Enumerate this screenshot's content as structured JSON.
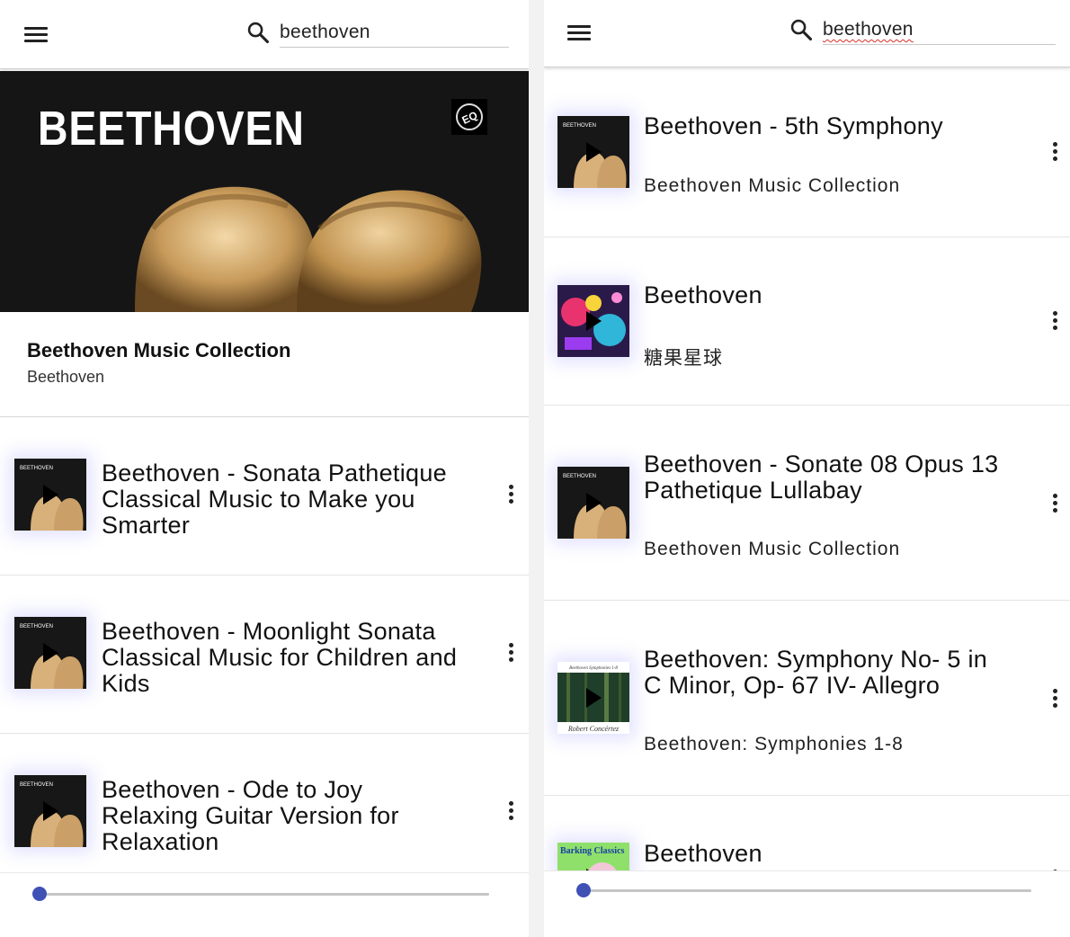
{
  "left": {
    "search": {
      "value": "beethoven"
    },
    "album": {
      "banner_text": "BEETHOVEN",
      "badge": "EQ",
      "title": "Beethoven Music Collection",
      "artist": "Beethoven"
    },
    "tracks": [
      {
        "title_lines": [
          "Beethoven - Sonata Pathetique",
          "Classical Music to Make you",
          "Smarter"
        ],
        "thumb": "beethoven-album-art"
      },
      {
        "title_lines": [
          "Beethoven - Moonlight Sonata",
          "Classical Music for Children and",
          "Kids"
        ],
        "thumb": "beethoven-album-art"
      },
      {
        "title_lines": [
          "Beethoven - Ode to Joy",
          "Relaxing Guitar Version for",
          "Relaxation"
        ],
        "thumb": "beethoven-album-art"
      }
    ],
    "player": {
      "progress": 0
    }
  },
  "right": {
    "search": {
      "value": "beethoven"
    },
    "tracks": [
      {
        "title_lines": [
          "Beethoven - 5th Symphony"
        ],
        "subtitle": "Beethoven Music Collection",
        "thumb": "beethoven-album-art"
      },
      {
        "title_lines": [
          "Beethoven"
        ],
        "subtitle": "糖果星球",
        "thumb": "colorful-cartoon-art"
      },
      {
        "title_lines": [
          "Beethoven - Sonate 08 Opus 13",
          "Pathetique Lullabay"
        ],
        "subtitle": "Beethoven Music Collection",
        "thumb": "beethoven-album-art"
      },
      {
        "title_lines": [
          "Beethoven: Symphony No- 5 in",
          "C Minor, Op- 67 IV- Allegro"
        ],
        "subtitle": "Beethoven: Symphonies 1-8",
        "thumb": "forest-album-art",
        "thumb_text": {
          "top": "Beethoven Symphonies 1-8",
          "bottom": "Robert Concértez"
        }
      },
      {
        "title_lines": [
          "Beethoven"
        ],
        "thumb": "barking-classics-art",
        "thumb_text": {
          "top": "Barking Classics"
        }
      }
    ],
    "player": {
      "progress": 0
    }
  },
  "colors": {
    "accent": "#3f51b5",
    "banner_bg": "#151515",
    "thumb_glow": "#7878ff"
  }
}
